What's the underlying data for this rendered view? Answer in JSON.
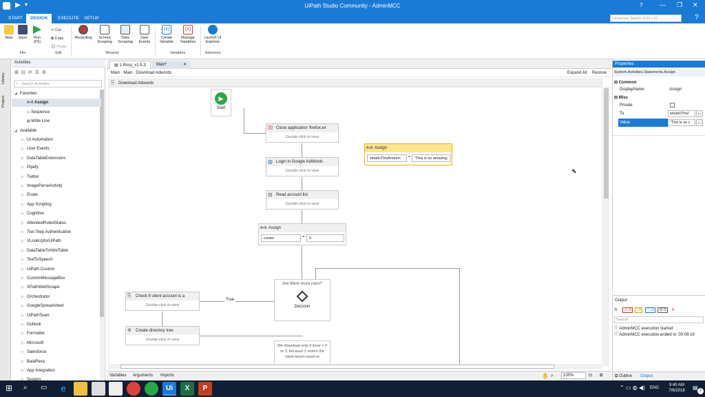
{
  "window": {
    "title": "UiPath Studio Community - AdminMCC",
    "help": "?"
  },
  "ribbon": {
    "tabs": [
      "START",
      "DESIGN",
      "EXECUTE",
      "SETUP"
    ],
    "new": "New",
    "save": "Save",
    "run": "Run",
    "run_key": "(F5)",
    "cut": "Cut",
    "copy": "Copy",
    "paste": "Paste",
    "recording": "Recording",
    "screen_scraping": "Screen Scraping",
    "data_scraping": "Data Scraping",
    "user_events": "User Events",
    "create_variable": "Create Variable",
    "manage_variables": "Manage Variables",
    "launch_explorer": "Launch UI Explorer",
    "groups": {
      "file": "File",
      "edit": "Edit",
      "wizards": "Wizards",
      "variables": "Variables",
      "selectors": "Selectors"
    },
    "search_placeholder": "Universal Search (Ctrl + F)"
  },
  "left_strip": {
    "library": "Library",
    "project": "Project"
  },
  "activities": {
    "title": "Activities",
    "search_placeholder": "Search Activities",
    "favorites_label": "Favorites",
    "favorites": [
      "Assign",
      "Sequence",
      "Write Line"
    ],
    "available_label": "Available",
    "available": [
      "UI Automation",
      "User Events",
      "DataTableExtensions",
      "Pipefy",
      "Twitter",
      "ImageParseActivity",
      "Enate",
      "App Scripting",
      "Cognitive",
      "AttendedRobotStatus",
      "Two Step Authentication",
      "VLookUpforUiPath",
      "DataTableToHtmlTable",
      "TextToSpeech",
      "UiPath Custom",
      "CustomMessageBox",
      "XPathWebScrape",
      "Orchestrator",
      "GoogleSpreadsheet",
      "UiPathTeam",
      "Outlook",
      "Formatter",
      "Microsoft",
      "Salesforce",
      "BalaReva",
      "App Integration",
      "System"
    ]
  },
  "designer": {
    "tabs": [
      "1.Rosy_v1.5.3",
      "Main*"
    ],
    "breadcrumb": [
      "Main",
      "Main",
      "Download Adwords"
    ],
    "expand_all": "Expand All",
    "restore": "Restore",
    "sequence_title": "Download Adwords",
    "start_label": "Start",
    "double_click": "Double-click to view",
    "nodes": {
      "close_app": "Close application 'firefox.ex",
      "login": "Login in Google AdWords",
      "read_list": "Read account list",
      "assign_main": "Assign",
      "assign_to": "contor",
      "assign_value": "0",
      "equals": "=",
      "assign_float": "Assign",
      "float_to": "whatIsThisAmazin",
      "float_value": "\"This is so amazing",
      "decision_title": "Are there more rows?",
      "decision_label": "Decision",
      "true_label": "True",
      "check_client": "Check if client account is a",
      "create_dir": "Create directory tree",
      "note": "We download only if done > 0 or 3, because 2 marks the client whom need no"
    }
  },
  "status_bar": {
    "tabs": [
      "Variables",
      "Arguments",
      "Imports"
    ],
    "zoom": "100%"
  },
  "properties": {
    "title": "Properties",
    "type": "System.Activities.Statements.Assign",
    "common": "Common",
    "display_name_label": "DisplayName",
    "display_name_value": "Assign",
    "misc": "Misc",
    "private_label": "Private",
    "to_label": "To",
    "to_value": "whatIsThis/",
    "value_label": "Value",
    "value_value": "\"This is so c",
    "ellipsis": "..."
  },
  "output": {
    "title": "Output",
    "counts": [
      "0",
      "0",
      "2",
      "0"
    ],
    "search_placeholder": "Search",
    "lines": [
      "AdminMCC execution started",
      "AdminMCC execution ended in: 00:09.19"
    ],
    "tabs": [
      "Outline",
      "Output"
    ]
  },
  "taskbar": {
    "lang": "ENG",
    "time": "9:40 AM",
    "date": "7/6/2018",
    "notif": "2"
  }
}
